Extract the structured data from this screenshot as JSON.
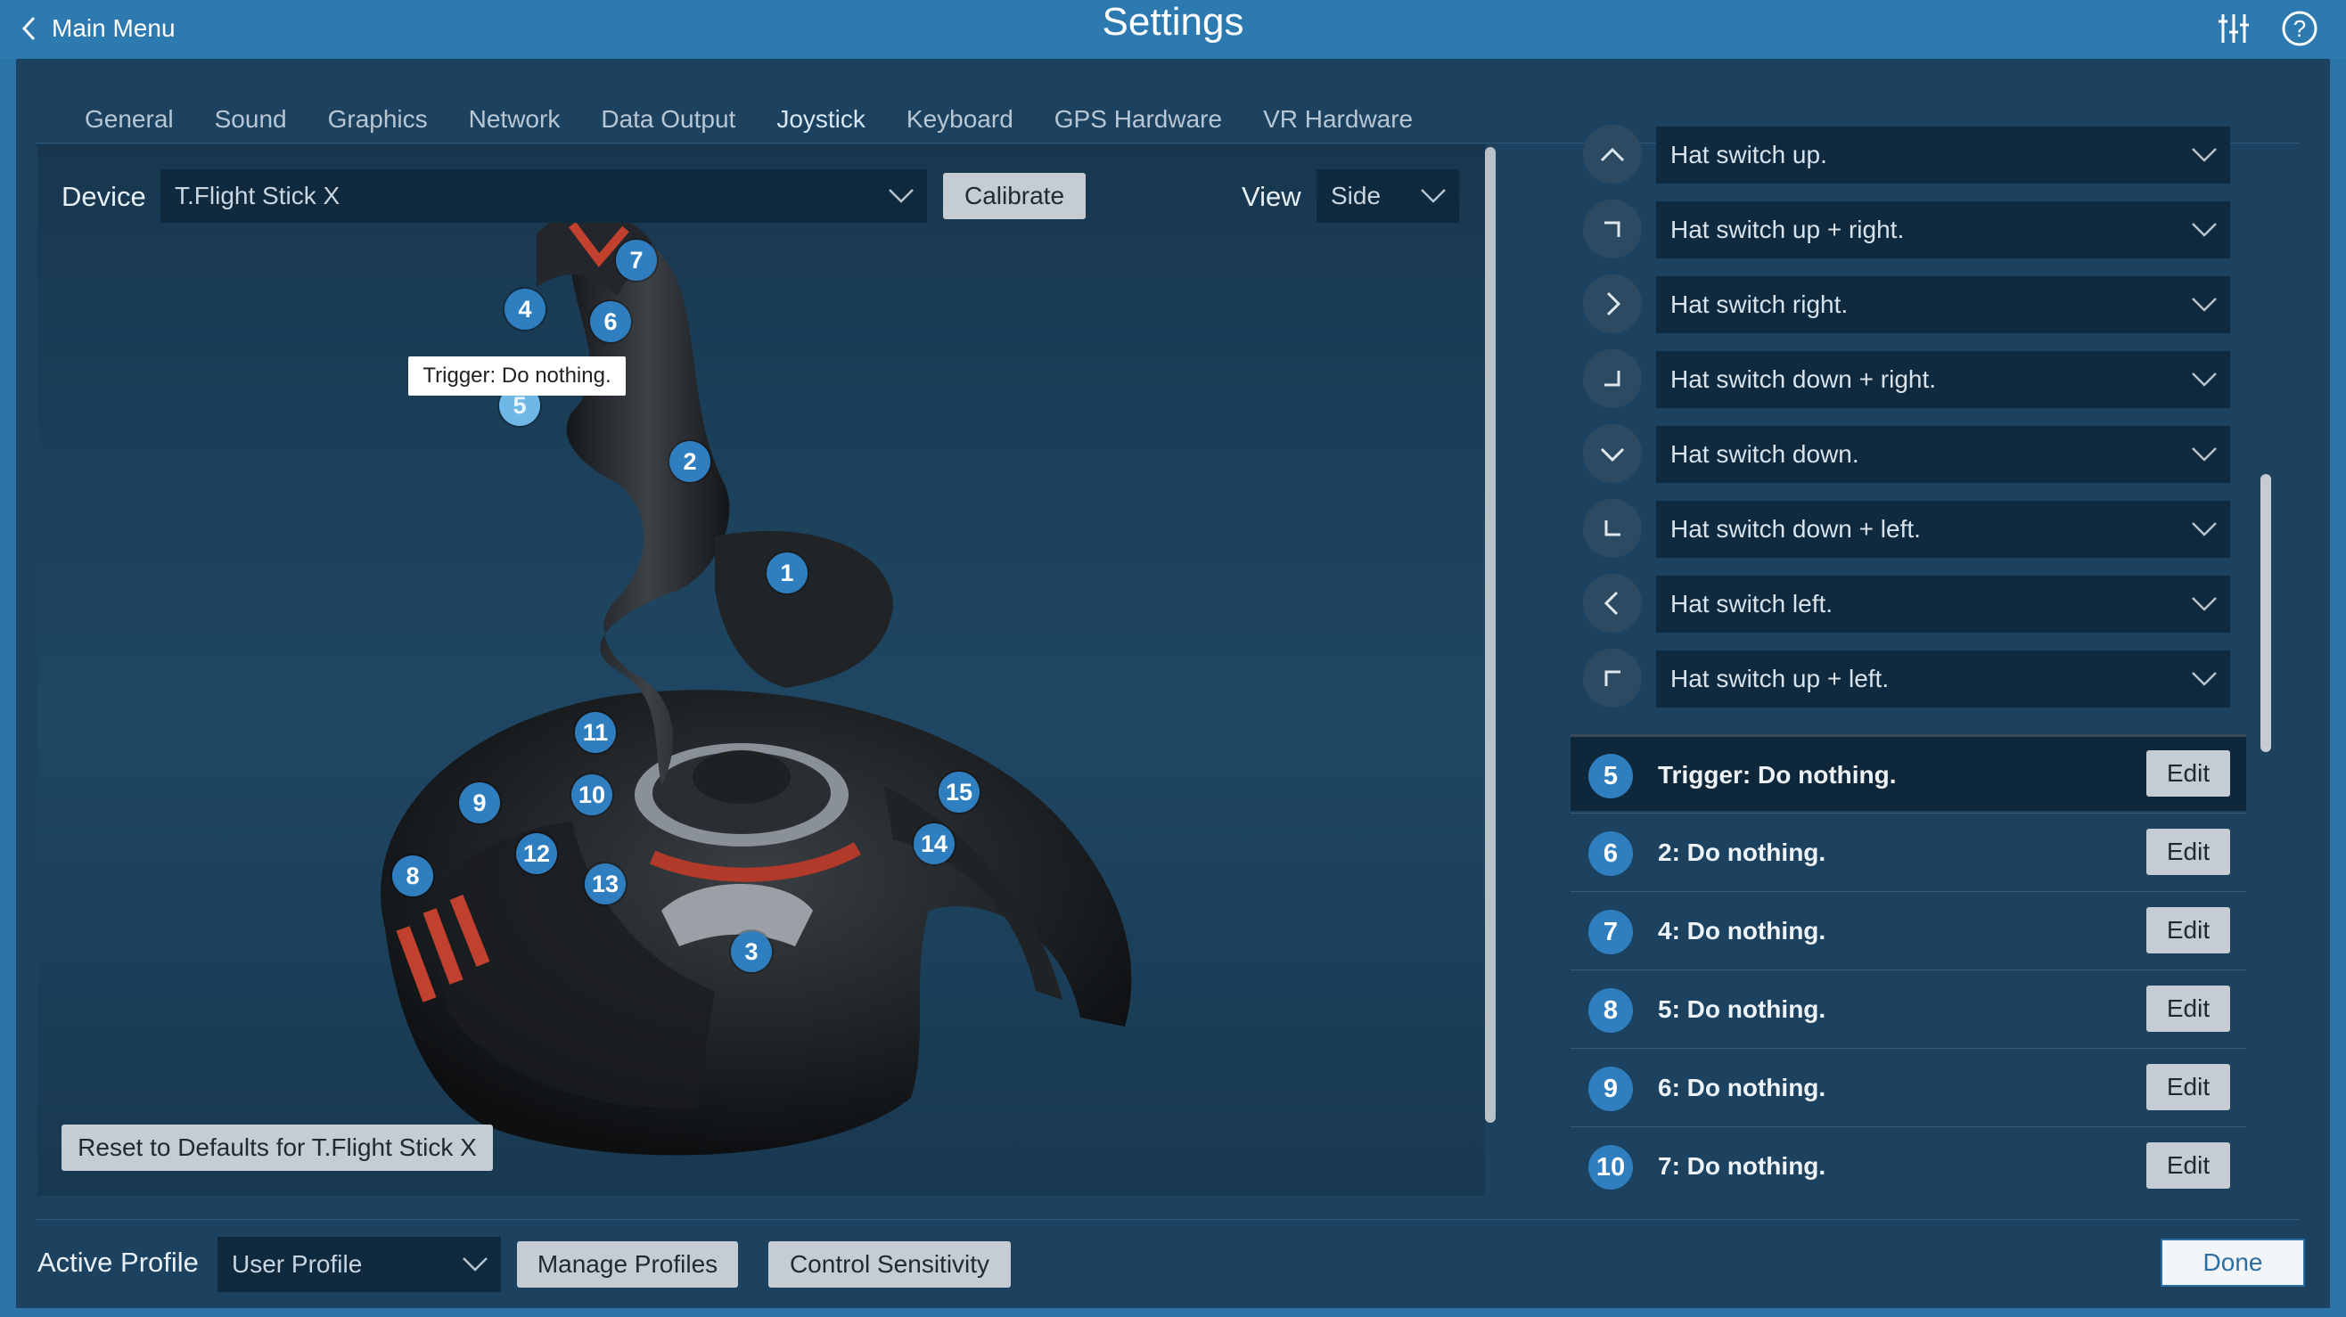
{
  "header": {
    "back_label": "Main Menu",
    "title": "Settings",
    "icons": [
      "sliders-icon",
      "help-icon"
    ]
  },
  "tabs": [
    {
      "label": "General",
      "active": false
    },
    {
      "label": "Sound",
      "active": false
    },
    {
      "label": "Graphics",
      "active": false
    },
    {
      "label": "Network",
      "active": false
    },
    {
      "label": "Data Output",
      "active": false
    },
    {
      "label": "Joystick",
      "active": true
    },
    {
      "label": "Keyboard",
      "active": false
    },
    {
      "label": "GPS Hardware",
      "active": false
    },
    {
      "label": "VR Hardware",
      "active": false
    }
  ],
  "device": {
    "label": "Device",
    "selected": "T.Flight Stick X",
    "calibrate_label": "Calibrate",
    "view_label": "View",
    "view_selected": "Side"
  },
  "joystick": {
    "tooltip": "Trigger: Do nothing.",
    "pins": [
      "1",
      "2",
      "3",
      "4",
      "5",
      "6",
      "7",
      "8",
      "9",
      "10",
      "11",
      "12",
      "13",
      "14",
      "15"
    ],
    "highlighted_pin": "5",
    "reset_label": "Reset to Defaults for T.Flight Stick X"
  },
  "hat_switch_rows": [
    {
      "icon": "chevron-up-icon",
      "value": "Hat switch up."
    },
    {
      "icon": "corner-up-right-icon",
      "value": "Hat switch up + right."
    },
    {
      "icon": "chevron-right-icon",
      "value": "Hat switch right."
    },
    {
      "icon": "corner-down-right-icon",
      "value": "Hat switch down + right."
    },
    {
      "icon": "chevron-down-icon",
      "value": "Hat switch down."
    },
    {
      "icon": "corner-down-left-icon",
      "value": "Hat switch down + left."
    },
    {
      "icon": "chevron-left-icon",
      "value": "Hat switch left."
    },
    {
      "icon": "corner-up-left-icon",
      "value": "Hat switch up + left."
    }
  ],
  "button_assignments": [
    {
      "number": "5",
      "text": "Trigger: Do nothing.",
      "edit_label": "Edit",
      "selected": true
    },
    {
      "number": "6",
      "text": "2: Do nothing.",
      "edit_label": "Edit",
      "selected": false
    },
    {
      "number": "7",
      "text": "4: Do nothing.",
      "edit_label": "Edit",
      "selected": false
    },
    {
      "number": "8",
      "text": "5: Do nothing.",
      "edit_label": "Edit",
      "selected": false
    },
    {
      "number": "9",
      "text": "6: Do nothing.",
      "edit_label": "Edit",
      "selected": false
    },
    {
      "number": "10",
      "text": "7: Do nothing.",
      "edit_label": "Edit",
      "selected": false
    }
  ],
  "footer": {
    "active_profile_label": "Active Profile",
    "profile_selected": "User Profile",
    "manage_profiles_label": "Manage Profiles",
    "control_sensitivity_label": "Control Sensitivity",
    "done_label": "Done"
  },
  "colors": {
    "header_blue": "#2d7ab1",
    "panel": "#1c4260",
    "accent": "#2f7ec0",
    "dropdown": "#0f2a3f"
  }
}
